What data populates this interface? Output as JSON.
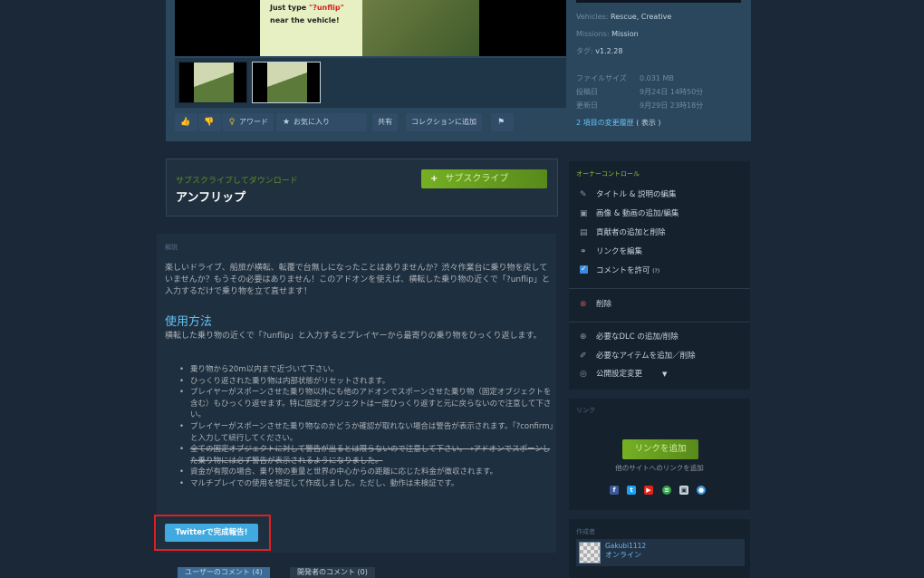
{
  "media": {
    "caption_line1_prefix": "Just type ",
    "caption_highlight": "\"?unflip\"",
    "caption_line2": "near the vehicle!"
  },
  "actions": {
    "thumbs_up_icon": "thumbs-up-icon",
    "thumbs_down_icon": "thumbs-down-icon",
    "award": "アワード",
    "favorite": "お気に入り",
    "share": "共有",
    "add_to_collection": "コレクションに追加",
    "flag_icon": "flag-icon"
  },
  "details": {
    "vehicles_key": "Vehicles:",
    "vehicles_val": "Rescue, Creative",
    "missions_key": "Missions:",
    "missions_val": "Mission",
    "tags_key": "タグ:",
    "tags_val": "v1.2.28",
    "filesize_key": "ファイルサイズ",
    "filesize_val": "0.031 MB",
    "posted_key": "投稿日",
    "posted_val": "9月24日 14時50分",
    "updated_key": "更新日",
    "updated_val": "9月29日 23時18分",
    "changes_link": "2 項目の変更履歴",
    "changes_show": "( 表示 )"
  },
  "subscribe": {
    "label": "サブスクライブしてダウンロード",
    "title": "アンフリップ",
    "button": "サブスクライブ"
  },
  "description": {
    "label": "解説",
    "text": "楽しいドライブ、船旅が横転、転覆で台無しになったことはありませんか？渋々作業台に乗り物を戻していませんか？もうその必要はありません！このアドオンを使えば、横転した乗り物の近くで「?unflip」と入力するだけで乗り物を立て直せます！",
    "usage_heading": "使用方法",
    "usage_text": "横転した乗り物の近くで「?unflip」と入力するとプレイヤーから最寄りの乗り物をひっくり返します。",
    "notes": [
      "乗り物から20m以内まで近づいて下さい。",
      "ひっくり返された乗り物は内部状態がリセットされます。",
      "プレイヤーがスポーンさせた乗り物以外にも他のアドオンでスポーンさせた乗り物（固定オブジェクトを含む）もひっくり返せます。特に固定オブジェクトは一度ひっくり返すと元に戻らないので注意して下さい。",
      "プレイヤーがスポーンさせた乗り物なのかどうか確認が取れない場合は警告が表示されます。「?confirm」と入力して続行してください。",
      "全ての固定オブジェクトに対して警告が出るとは限らないので注意して下さい。",
      "→アドオンでスポーンした乗り物には必ず警告が表示されるようになりました。",
      "資金が有限の場合、乗り物の重量と世界の中心からの距離に応じた料金が徴収されます。",
      "マルチプレイでの使用を想定して作成しました。ただし、動作は未検証です。"
    ],
    "twitter_button": "Twitterで完成報告!"
  },
  "comments": {
    "user_tab": "ユーザーのコメント (4)",
    "dev_tab": "開発者のコメント (0)"
  },
  "owner": {
    "title": "オーナーコントロール",
    "edit_title": "タイトル & 説明の編集",
    "edit_media": "画像 & 動画の追加/編集",
    "contributors": "貢献者の追加と削除",
    "edit_links": "リンクを編集",
    "allow_comments": "コメントを許可",
    "allow_comments_q": "(?)",
    "delete": "削除",
    "required_dlc": "必要なDLC の追加/削除",
    "required_items": "必要なアイテムを追加／削除",
    "visibility": "公開設定変更"
  },
  "links": {
    "title": "リンク",
    "add_button": "リンクを追加",
    "sub": "他のサイトへのリンクを追加"
  },
  "author": {
    "title": "作成者",
    "name": "Gakubi1112",
    "status": "オンライン"
  },
  "colors": {
    "background": "#1b2838",
    "accent_green": "#75b022",
    "accent_blue": "#66c0f4",
    "highlight_red": "#e02020"
  }
}
